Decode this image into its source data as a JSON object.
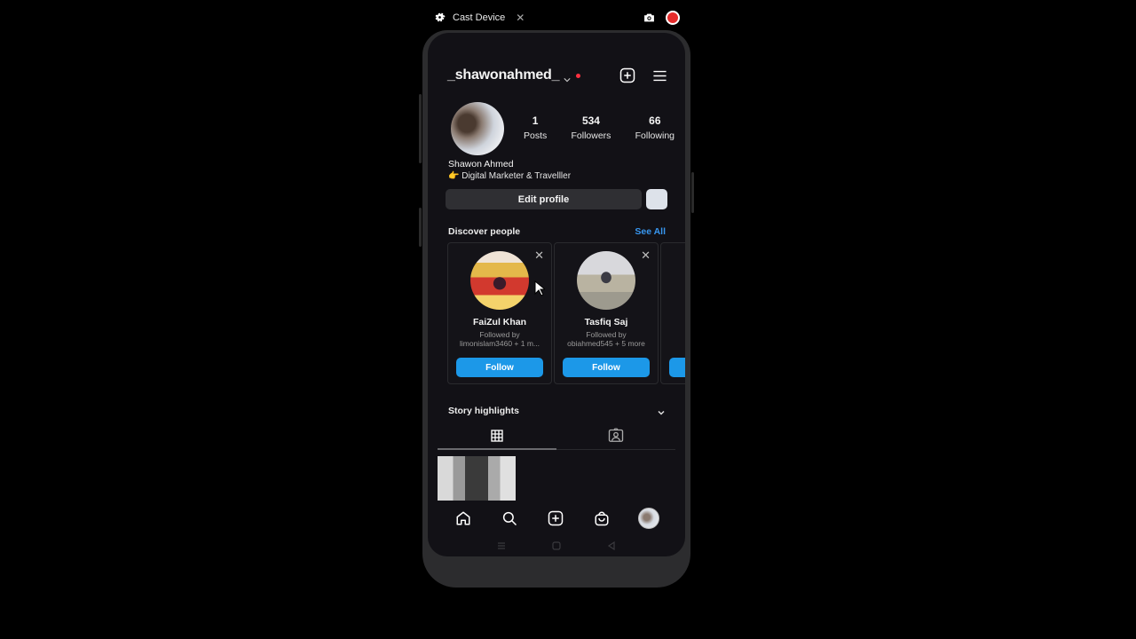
{
  "cast_bar": {
    "title": "Cast Device",
    "close_label": "✕",
    "icons": [
      "gear-icon",
      "camera-icon",
      "record-icon"
    ]
  },
  "header": {
    "username": "_shawonahmed_",
    "has_notification_dot": true,
    "icons": [
      "chevron-down-icon",
      "new-post-icon",
      "menu-icon"
    ]
  },
  "profile": {
    "full_name": "Shawon Ahmed",
    "bio": "👉 Digital Marketer & Travelller",
    "stats": [
      {
        "value": "1",
        "label": "Posts"
      },
      {
        "value": "534",
        "label": "Followers"
      },
      {
        "value": "66",
        "label": "Following"
      }
    ],
    "edit_label": "Edit profile"
  },
  "discover": {
    "title": "Discover people",
    "see_all": "See All",
    "cards": [
      {
        "name": "FaiZul Khan",
        "followed_by_label": "Followed by",
        "followed_by": "limonislam3460 + 1 m...",
        "button": "Follow"
      },
      {
        "name": "Tasfiq Saj",
        "followed_by_label": "Followed by",
        "followed_by": "obiahmed545 + 5 more",
        "button": "Follow"
      }
    ],
    "close_glyph": "✕"
  },
  "highlights": {
    "title": "Story highlights"
  },
  "tabs": [
    {
      "name": "grid-icon",
      "active": true
    },
    {
      "name": "tagged-icon",
      "active": false
    }
  ],
  "bottom_nav": [
    "home-icon",
    "search-icon",
    "create-icon",
    "shop-icon",
    "profile-avatar"
  ],
  "system_nav": [
    "recents-icon",
    "home-square-icon",
    "back-icon"
  ],
  "colors": {
    "accent": "#1c98e8",
    "link": "#3897f0",
    "background": "#121116",
    "notification": "#ff3040",
    "record": "#e52b2b"
  }
}
